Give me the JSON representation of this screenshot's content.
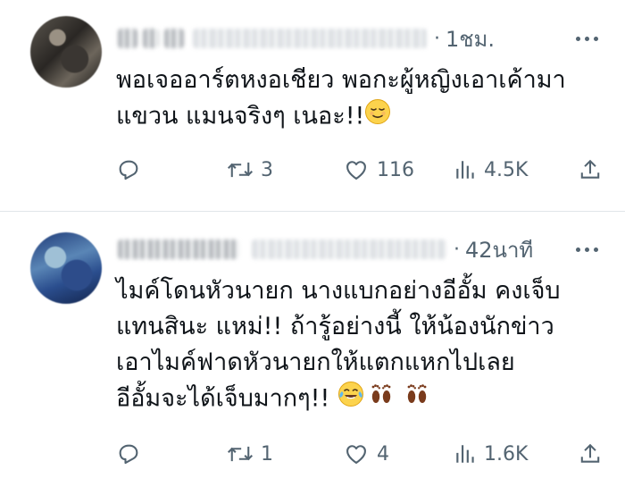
{
  "tweets": [
    {
      "time": "1ชม.",
      "dot": "·",
      "text": "พอเจออาร์ตหงอเชียว พอกะผู้หญิงเอาเค้ามา\nแขวน แมนจริงๆ เนอะ!!",
      "emojis": [
        "relieved-face"
      ],
      "counts": {
        "reply": "",
        "retweet": "3",
        "like": "116",
        "views": "4.5K"
      }
    },
    {
      "time": "42นาที",
      "dot": "·",
      "text": "ไมค์โดนหัวนายก นางแบกอย่างอีอั้ม คงเจ็บ\nแทนสินะ แหม่!! ถ้ารู้อย่างนี้ ให้น้องนักข่าว\nเอาไมค์ฟาดหัวนายกให้แตกแหกไปเลย\nอีอั้มจะได้เจ็บมากๆ!!",
      "emojis": [
        "tears-of-joy-face",
        "footprints",
        "footprints"
      ],
      "counts": {
        "reply": "",
        "retweet": "1",
        "like": "4",
        "views": "1.6K"
      }
    }
  ],
  "colors": {
    "text": "#0f1419",
    "muted": "#536471",
    "divider": "#e1e5e9"
  },
  "icons": [
    "reply-icon",
    "retweet-icon",
    "like-icon",
    "views-icon",
    "share-icon",
    "more-icon"
  ]
}
